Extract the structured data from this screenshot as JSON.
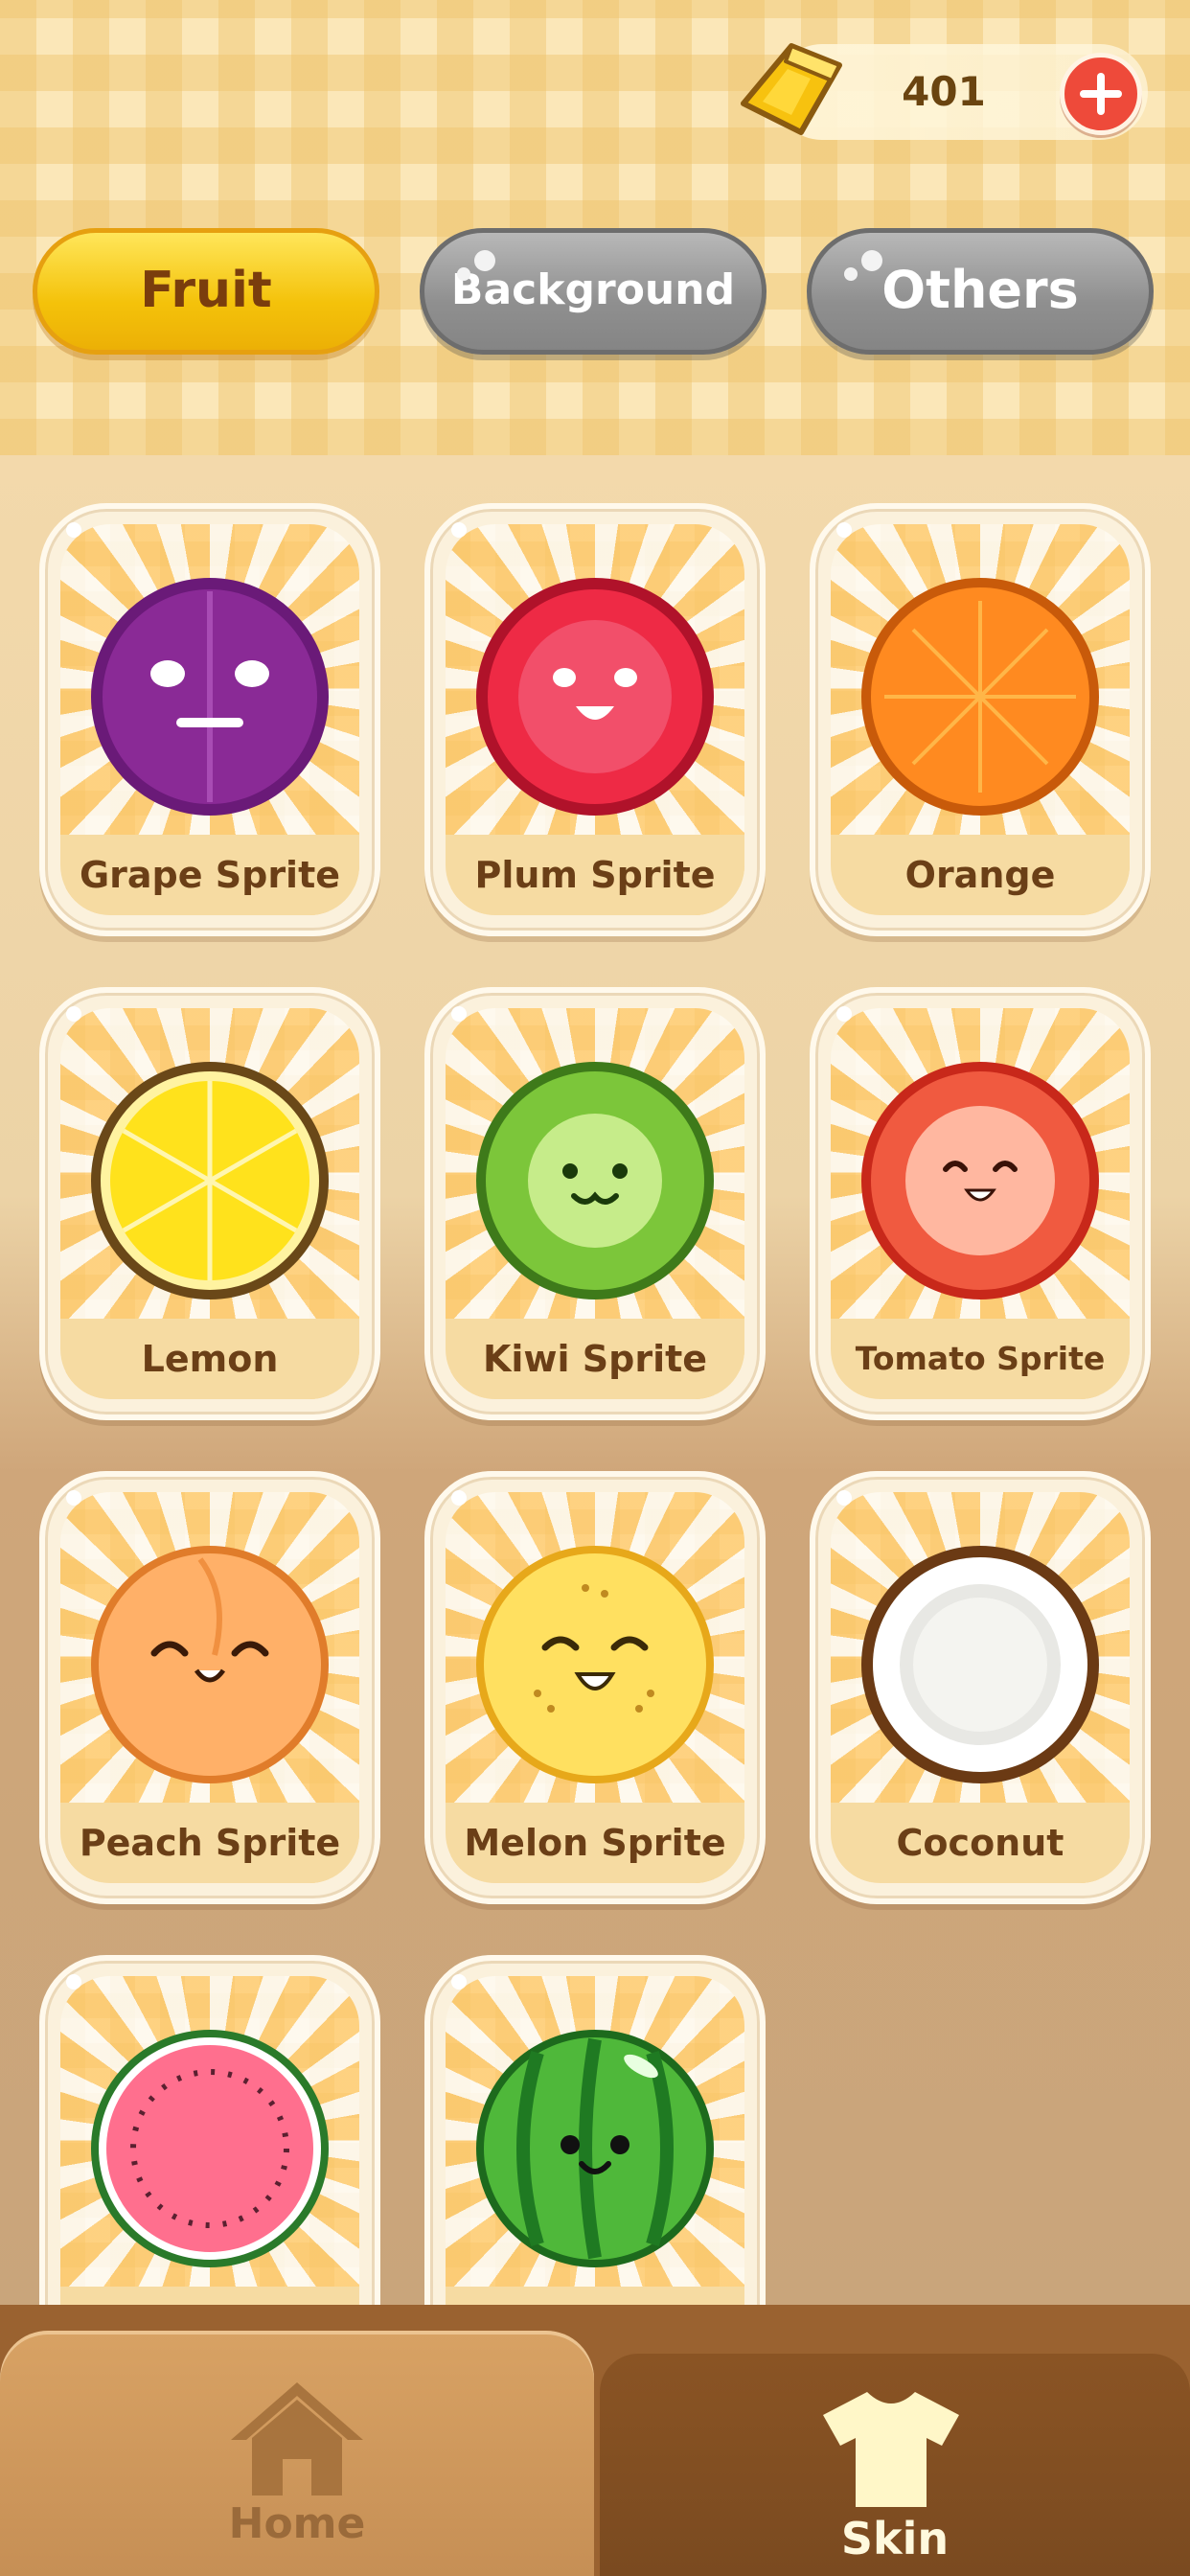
{
  "header": {
    "currency_icon": "gold-bar-icon",
    "currency_amount": "401",
    "add_icon": "plus-icon"
  },
  "tabs": [
    {
      "label": "Fruit",
      "selected": true
    },
    {
      "label": "Background",
      "selected": false
    },
    {
      "label": "Others",
      "selected": false
    }
  ],
  "skins": [
    {
      "name": "Grape Sprite",
      "icon": "grape-sprite-icon"
    },
    {
      "name": "Plum Sprite",
      "icon": "plum-sprite-icon"
    },
    {
      "name": "Orange",
      "icon": "orange-icon"
    },
    {
      "name": "Lemon",
      "icon": "lemon-icon"
    },
    {
      "name": "Kiwi Sprite",
      "icon": "kiwi-sprite-icon"
    },
    {
      "name": "Tomato Sprite",
      "icon": "tomato-sprite-icon"
    },
    {
      "name": "Peach Sprite",
      "icon": "peach-sprite-icon"
    },
    {
      "name": "Melon Sprite",
      "icon": "melon-sprite-icon"
    },
    {
      "name": "Coconut",
      "icon": "coconut-icon"
    },
    {
      "name": "",
      "icon": "watermelon-slice-icon"
    },
    {
      "name": "",
      "icon": "watermelon-sprite-icon"
    }
  ],
  "bottom_nav": {
    "home_label": "Home",
    "home_icon": "house-icon",
    "skin_label": "Skin",
    "skin_icon": "tshirt-icon",
    "active": "Skin"
  },
  "colors": {
    "active_tab": "#f4c20a",
    "inactive_tab": "#8f8f8f",
    "nav_active": "#7a4a20",
    "nav_inactive": "#c68f55"
  }
}
